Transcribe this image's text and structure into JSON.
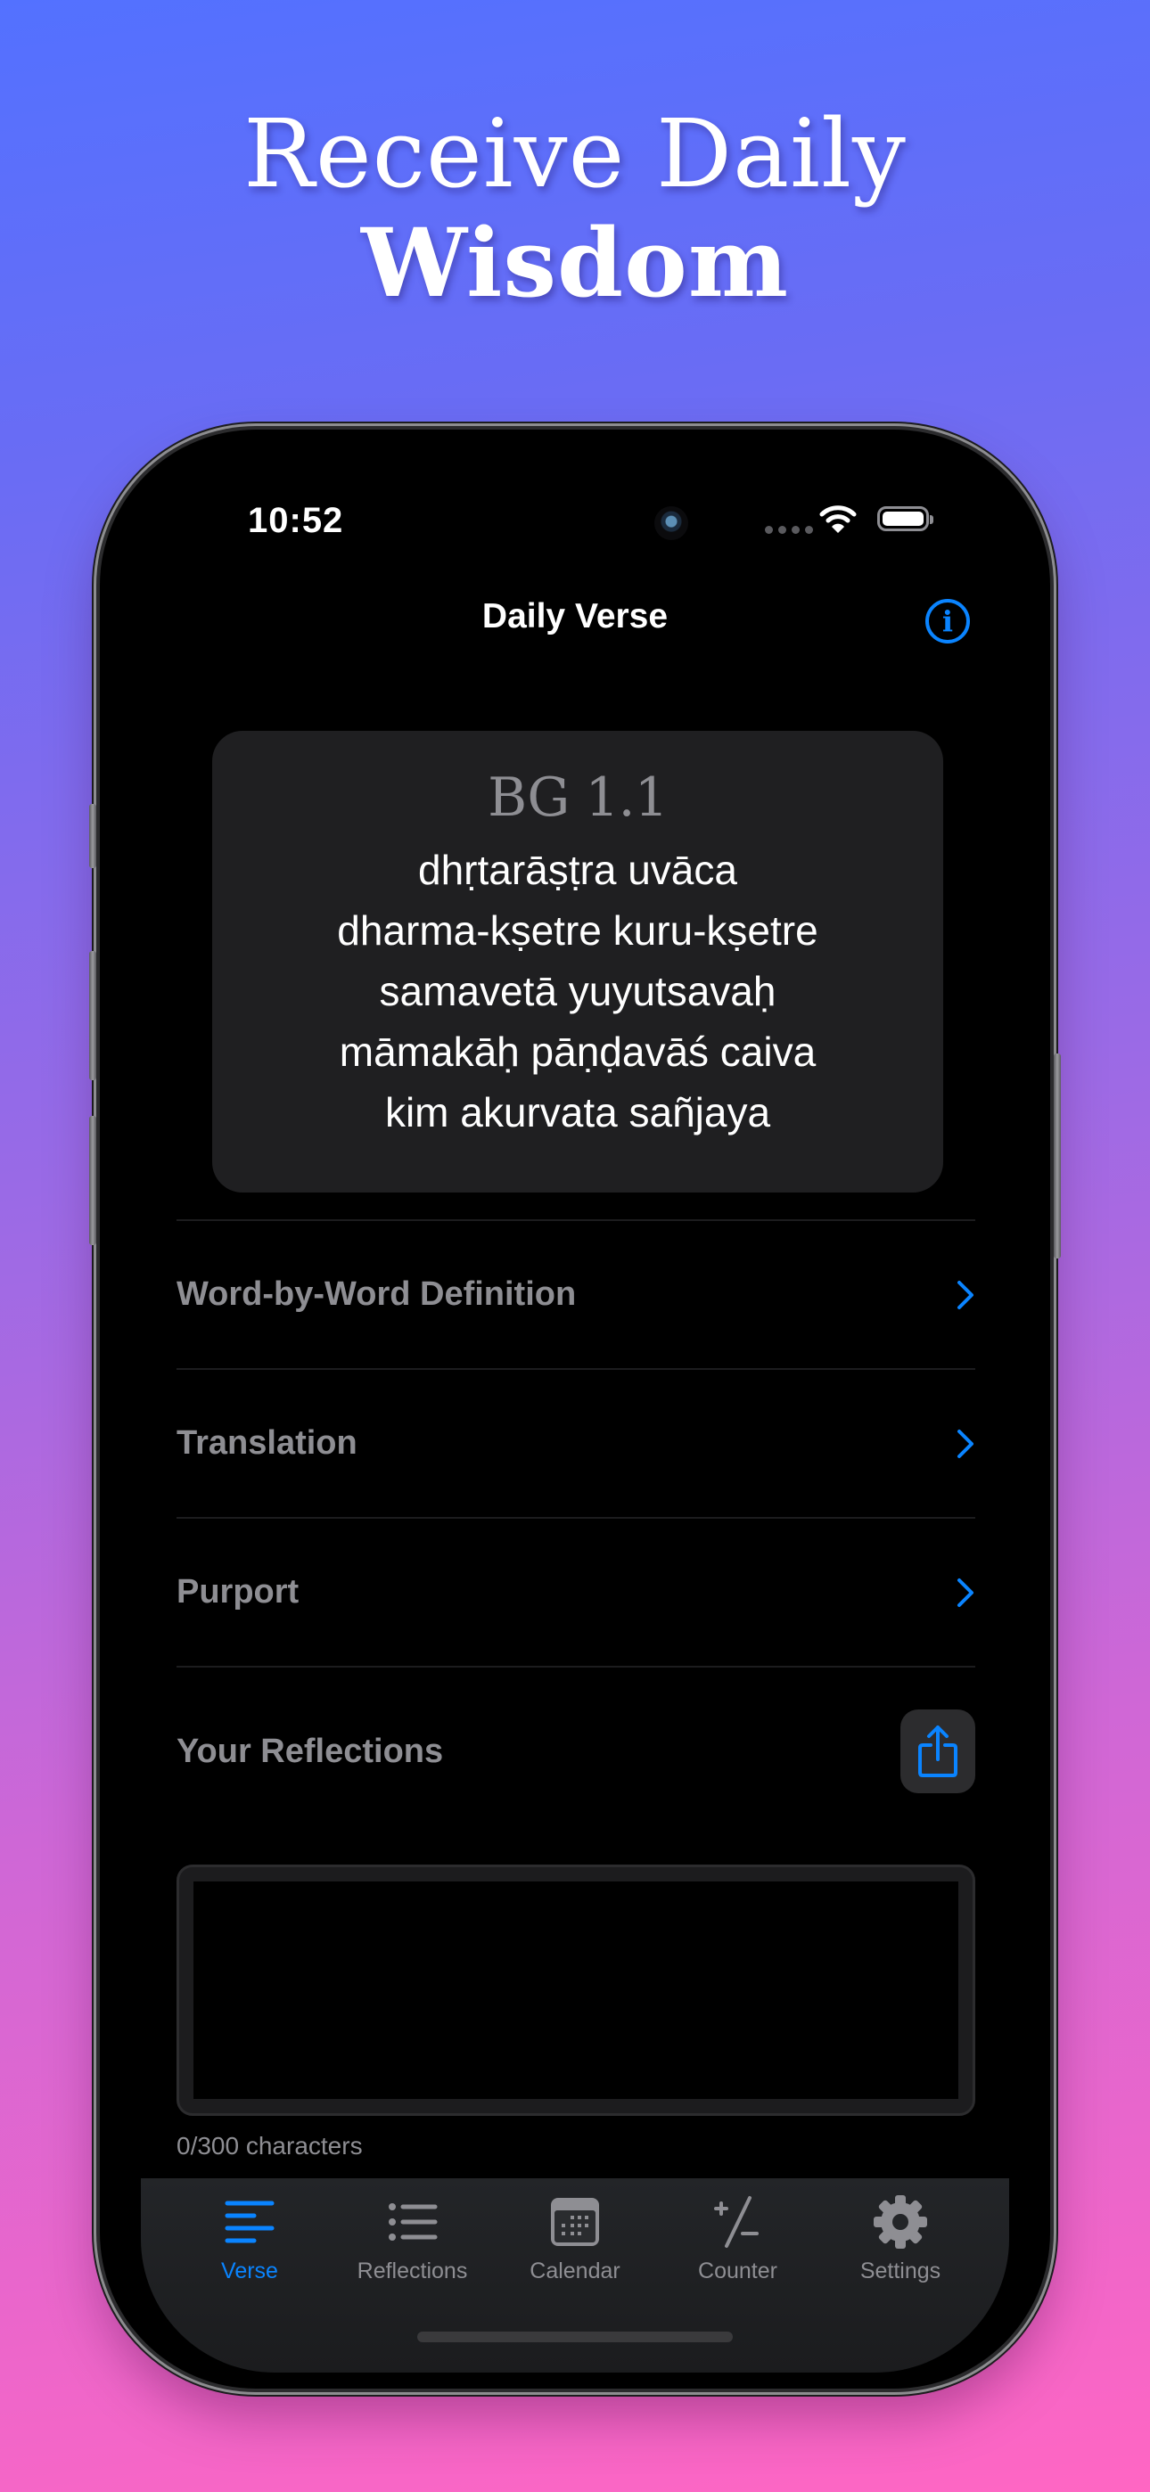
{
  "promo": {
    "headline_line1": "Receive Daily",
    "headline_line2": "Wisdom",
    "gradient_colors": [
      "#5371ff",
      "#9a6ae6",
      "#ff66c3"
    ]
  },
  "status_bar": {
    "time": "10:52",
    "icons": [
      "camera-dot",
      "signal-dots",
      "wifi-icon",
      "battery-icon"
    ]
  },
  "nav": {
    "title": "Daily Verse",
    "info_icon": "info-circle-icon",
    "accent_color": "#0a84ff"
  },
  "verse": {
    "reference": "BG 1.1",
    "lines": [
      "dhṛtarāṣṭra uvāca",
      "dharma-kṣetre kuru-kṣetre",
      "samavetā yuyutsavaḥ",
      "māmakāḥ pāṇḍavāś caiva",
      "kim akurvata sañjaya"
    ]
  },
  "sections": [
    {
      "label": "Word-by-Word Definition",
      "icon": "chevron-right-icon"
    },
    {
      "label": "Translation",
      "icon": "chevron-right-icon"
    },
    {
      "label": "Purport",
      "icon": "chevron-right-icon"
    }
  ],
  "reflections": {
    "title": "Your Reflections",
    "share_icon": "share-icon",
    "value": "",
    "char_count": "0/300 characters"
  },
  "tabbar": {
    "tabs": [
      {
        "label": "Verse",
        "icon": "text-align-left-icon",
        "active": true
      },
      {
        "label": "Reflections",
        "icon": "list-bullet-icon",
        "active": false
      },
      {
        "label": "Calendar",
        "icon": "calendar-icon",
        "active": false
      },
      {
        "label": "Counter",
        "icon": "plus-minus-icon",
        "active": false
      },
      {
        "label": "Settings",
        "icon": "gear-icon",
        "active": false
      }
    ]
  }
}
